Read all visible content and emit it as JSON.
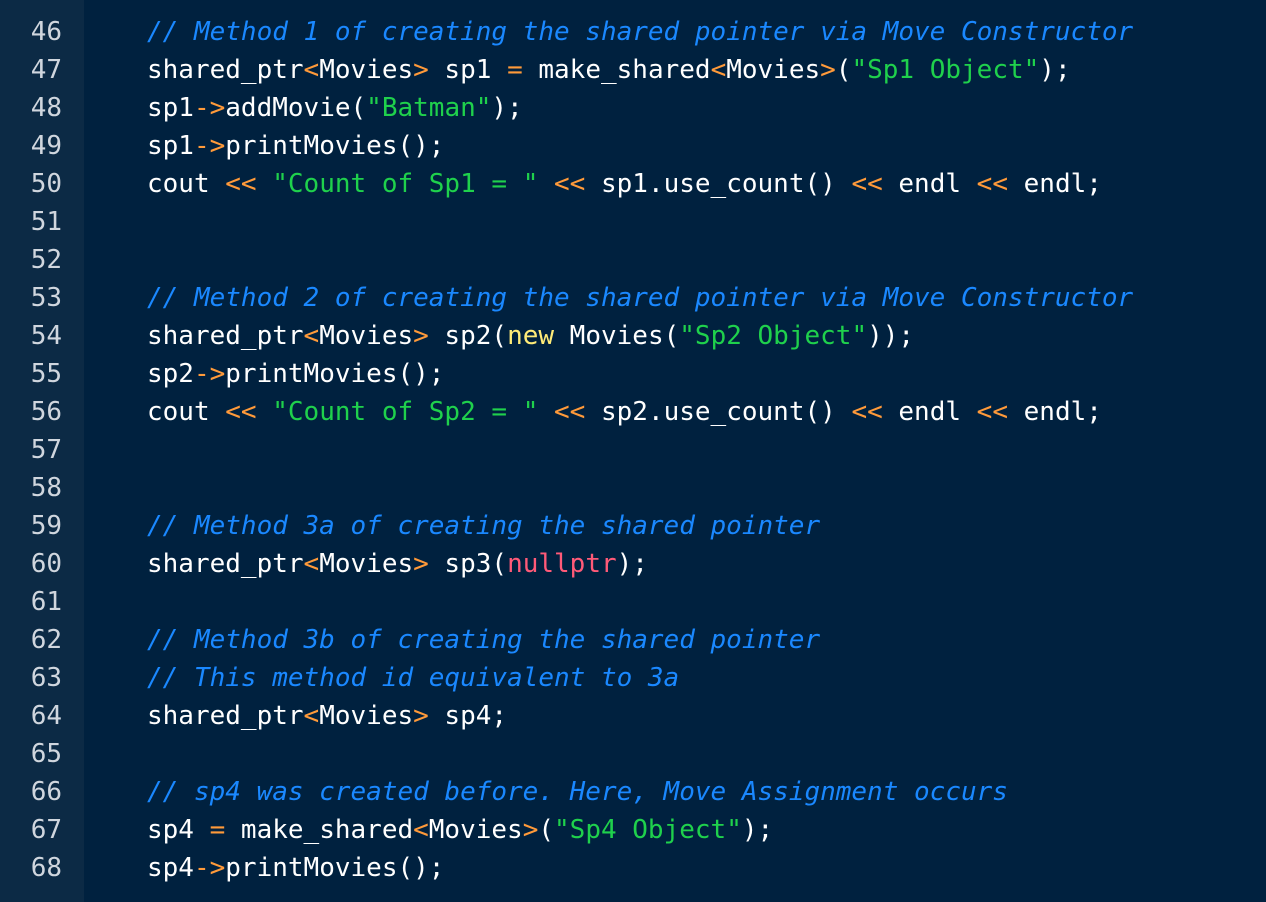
{
  "colors": {
    "background": "#00213f",
    "gutter": "#0c2a45",
    "line_number": "#d0d6de",
    "plain": "#ffffff",
    "comment": "#1a88ff",
    "string": "#1fd14c",
    "operator": "#ff9a3a",
    "keyword": "#ffec78",
    "null": "#ff5a78"
  },
  "lines": [
    {
      "number": "46",
      "tokens": [
        {
          "t": "// Method 1 of creating the shared pointer via Move Constructor",
          "c": "comment"
        }
      ]
    },
    {
      "number": "47",
      "tokens": [
        {
          "t": "shared_ptr",
          "c": "plain"
        },
        {
          "t": "<",
          "c": "op"
        },
        {
          "t": "Movies",
          "c": "plain"
        },
        {
          "t": ">",
          "c": "op"
        },
        {
          "t": " sp1 ",
          "c": "plain"
        },
        {
          "t": "=",
          "c": "op"
        },
        {
          "t": " make_shared",
          "c": "plain"
        },
        {
          "t": "<",
          "c": "op"
        },
        {
          "t": "Movies",
          "c": "plain"
        },
        {
          "t": ">",
          "c": "op"
        },
        {
          "t": "(",
          "c": "plain"
        },
        {
          "t": "\"Sp1 Object\"",
          "c": "string"
        },
        {
          "t": ");",
          "c": "plain"
        }
      ]
    },
    {
      "number": "48",
      "tokens": [
        {
          "t": "sp1",
          "c": "plain"
        },
        {
          "t": "->",
          "c": "op"
        },
        {
          "t": "addMovie(",
          "c": "plain"
        },
        {
          "t": "\"Batman\"",
          "c": "string"
        },
        {
          "t": ");",
          "c": "plain"
        }
      ]
    },
    {
      "number": "49",
      "tokens": [
        {
          "t": "sp1",
          "c": "plain"
        },
        {
          "t": "->",
          "c": "op"
        },
        {
          "t": "printMovies();",
          "c": "plain"
        }
      ]
    },
    {
      "number": "50",
      "tokens": [
        {
          "t": "cout ",
          "c": "plain"
        },
        {
          "t": "<<",
          "c": "op"
        },
        {
          "t": " ",
          "c": "plain"
        },
        {
          "t": "\"Count of Sp1 = \"",
          "c": "string"
        },
        {
          "t": " ",
          "c": "plain"
        },
        {
          "t": "<<",
          "c": "op"
        },
        {
          "t": " sp1.use_count() ",
          "c": "plain"
        },
        {
          "t": "<<",
          "c": "op"
        },
        {
          "t": " endl ",
          "c": "plain"
        },
        {
          "t": "<<",
          "c": "op"
        },
        {
          "t": " endl;",
          "c": "plain"
        }
      ]
    },
    {
      "number": "51",
      "tokens": []
    },
    {
      "number": "52",
      "tokens": []
    },
    {
      "number": "53",
      "tokens": [
        {
          "t": "// Method 2 of creating the shared pointer via Move Constructor",
          "c": "comment"
        }
      ]
    },
    {
      "number": "54",
      "tokens": [
        {
          "t": "shared_ptr",
          "c": "plain"
        },
        {
          "t": "<",
          "c": "op"
        },
        {
          "t": "Movies",
          "c": "plain"
        },
        {
          "t": ">",
          "c": "op"
        },
        {
          "t": " sp2(",
          "c": "plain"
        },
        {
          "t": "new",
          "c": "keyword"
        },
        {
          "t": " Movies(",
          "c": "plain"
        },
        {
          "t": "\"Sp2 Object\"",
          "c": "string"
        },
        {
          "t": "));",
          "c": "plain"
        }
      ]
    },
    {
      "number": "55",
      "tokens": [
        {
          "t": "sp2",
          "c": "plain"
        },
        {
          "t": "->",
          "c": "op"
        },
        {
          "t": "printMovies();",
          "c": "plain"
        }
      ]
    },
    {
      "number": "56",
      "tokens": [
        {
          "t": "cout ",
          "c": "plain"
        },
        {
          "t": "<<",
          "c": "op"
        },
        {
          "t": " ",
          "c": "plain"
        },
        {
          "t": "\"Count of Sp2 = \"",
          "c": "string"
        },
        {
          "t": " ",
          "c": "plain"
        },
        {
          "t": "<<",
          "c": "op"
        },
        {
          "t": " sp2.use_count() ",
          "c": "plain"
        },
        {
          "t": "<<",
          "c": "op"
        },
        {
          "t": " endl ",
          "c": "plain"
        },
        {
          "t": "<<",
          "c": "op"
        },
        {
          "t": " endl;",
          "c": "plain"
        }
      ]
    },
    {
      "number": "57",
      "tokens": []
    },
    {
      "number": "58",
      "tokens": []
    },
    {
      "number": "59",
      "tokens": [
        {
          "t": "// Method 3a of creating the shared pointer",
          "c": "comment"
        }
      ]
    },
    {
      "number": "60",
      "tokens": [
        {
          "t": "shared_ptr",
          "c": "plain"
        },
        {
          "t": "<",
          "c": "op"
        },
        {
          "t": "Movies",
          "c": "plain"
        },
        {
          "t": ">",
          "c": "op"
        },
        {
          "t": " sp3(",
          "c": "plain"
        },
        {
          "t": "nullptr",
          "c": "null"
        },
        {
          "t": ");",
          "c": "plain"
        }
      ]
    },
    {
      "number": "61",
      "tokens": []
    },
    {
      "number": "62",
      "tokens": [
        {
          "t": "// Method 3b of creating the shared pointer",
          "c": "comment"
        }
      ]
    },
    {
      "number": "63",
      "tokens": [
        {
          "t": "// This method id equivalent to 3a",
          "c": "comment"
        }
      ]
    },
    {
      "number": "64",
      "tokens": [
        {
          "t": "shared_ptr",
          "c": "plain"
        },
        {
          "t": "<",
          "c": "op"
        },
        {
          "t": "Movies",
          "c": "plain"
        },
        {
          "t": ">",
          "c": "op"
        },
        {
          "t": " sp4;",
          "c": "plain"
        }
      ]
    },
    {
      "number": "65",
      "tokens": []
    },
    {
      "number": "66",
      "tokens": [
        {
          "t": "// sp4 was created before. Here, Move Assignment occurs",
          "c": "comment"
        }
      ]
    },
    {
      "number": "67",
      "tokens": [
        {
          "t": "sp4 ",
          "c": "plain"
        },
        {
          "t": "=",
          "c": "op"
        },
        {
          "t": " make_shared",
          "c": "plain"
        },
        {
          "t": "<",
          "c": "op"
        },
        {
          "t": "Movies",
          "c": "plain"
        },
        {
          "t": ">",
          "c": "op"
        },
        {
          "t": "(",
          "c": "plain"
        },
        {
          "t": "\"Sp4 Object\"",
          "c": "string"
        },
        {
          "t": ");",
          "c": "plain"
        }
      ]
    },
    {
      "number": "68",
      "tokens": [
        {
          "t": "sp4",
          "c": "plain"
        },
        {
          "t": "->",
          "c": "op"
        },
        {
          "t": "printMovies();",
          "c": "plain"
        }
      ]
    }
  ]
}
